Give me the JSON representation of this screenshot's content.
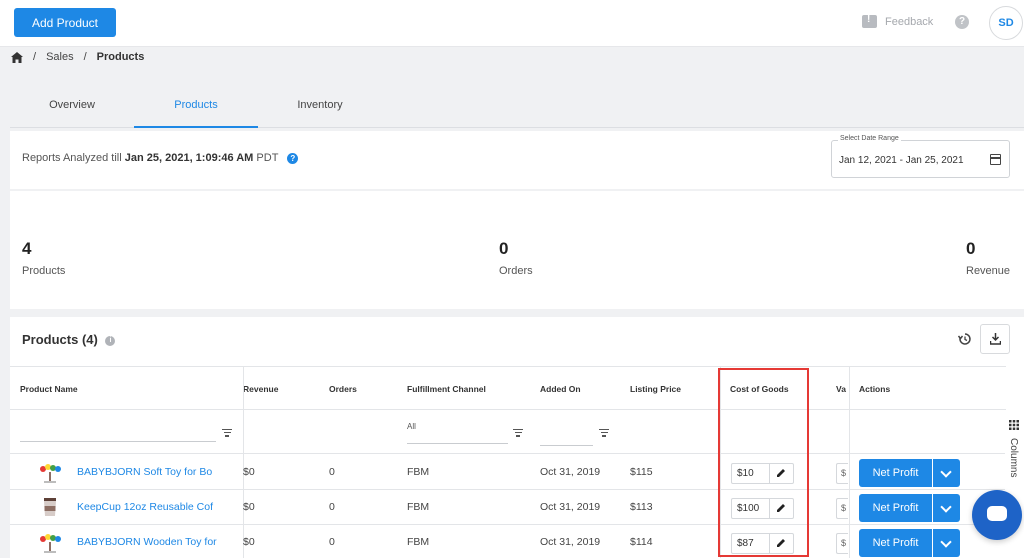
{
  "header": {
    "add_product_label": "Add Product",
    "feedback_label": "Feedback",
    "help_label": "?",
    "avatar_initials": "SD"
  },
  "breadcrumb": {
    "sep": "/",
    "sales": "Sales",
    "current": "Products"
  },
  "tabs": [
    "Overview",
    "Products",
    "Inventory"
  ],
  "report": {
    "prefix": "Reports Analyzed till",
    "timestamp": "Jan 25, 2021, 1:09:46 AM",
    "timezone": "PDT",
    "date_range_label": "Select Date Range",
    "date_range_value": "Jan 12, 2021 - Jan 25, 2021"
  },
  "stats": [
    {
      "value": "4",
      "label": "Products"
    },
    {
      "value": "0",
      "label": "Orders"
    },
    {
      "value": "0",
      "label": "Revenue"
    }
  ],
  "products": {
    "title": "Products (4)",
    "columns": [
      "Product Name",
      "Revenue",
      "Orders",
      "Fulfillment Channel",
      "Added On",
      "Listing Price",
      "Cost of Goods",
      "Va",
      "Actions"
    ],
    "fulfillment_filter": "All",
    "rows": [
      {
        "name": "BABYBJORN Soft Toy for Bo",
        "revenue": "$0",
        "orders": "0",
        "channel": "FBM",
        "added": "Oct 31, 2019",
        "price": "$115",
        "cog": "$10",
        "action": "Net Profit"
      },
      {
        "name": "KeepCup 12oz Reusable Cof",
        "revenue": "$0",
        "orders": "0",
        "channel": "FBM",
        "added": "Oct 31, 2019",
        "price": "$113",
        "cog": "$100",
        "action": "Net Profit"
      },
      {
        "name": "BABYBJORN Wooden Toy for",
        "revenue": "$0",
        "orders": "0",
        "channel": "FBM",
        "added": "Oct 31, 2019",
        "price": "$114",
        "cog": "$87",
        "action": "Net Profit"
      }
    ],
    "var_glyph": "$"
  },
  "side_panel": {
    "columns_label": "Columns"
  },
  "colors": {
    "accent": "#1e88e5",
    "highlight": "#e53935"
  }
}
